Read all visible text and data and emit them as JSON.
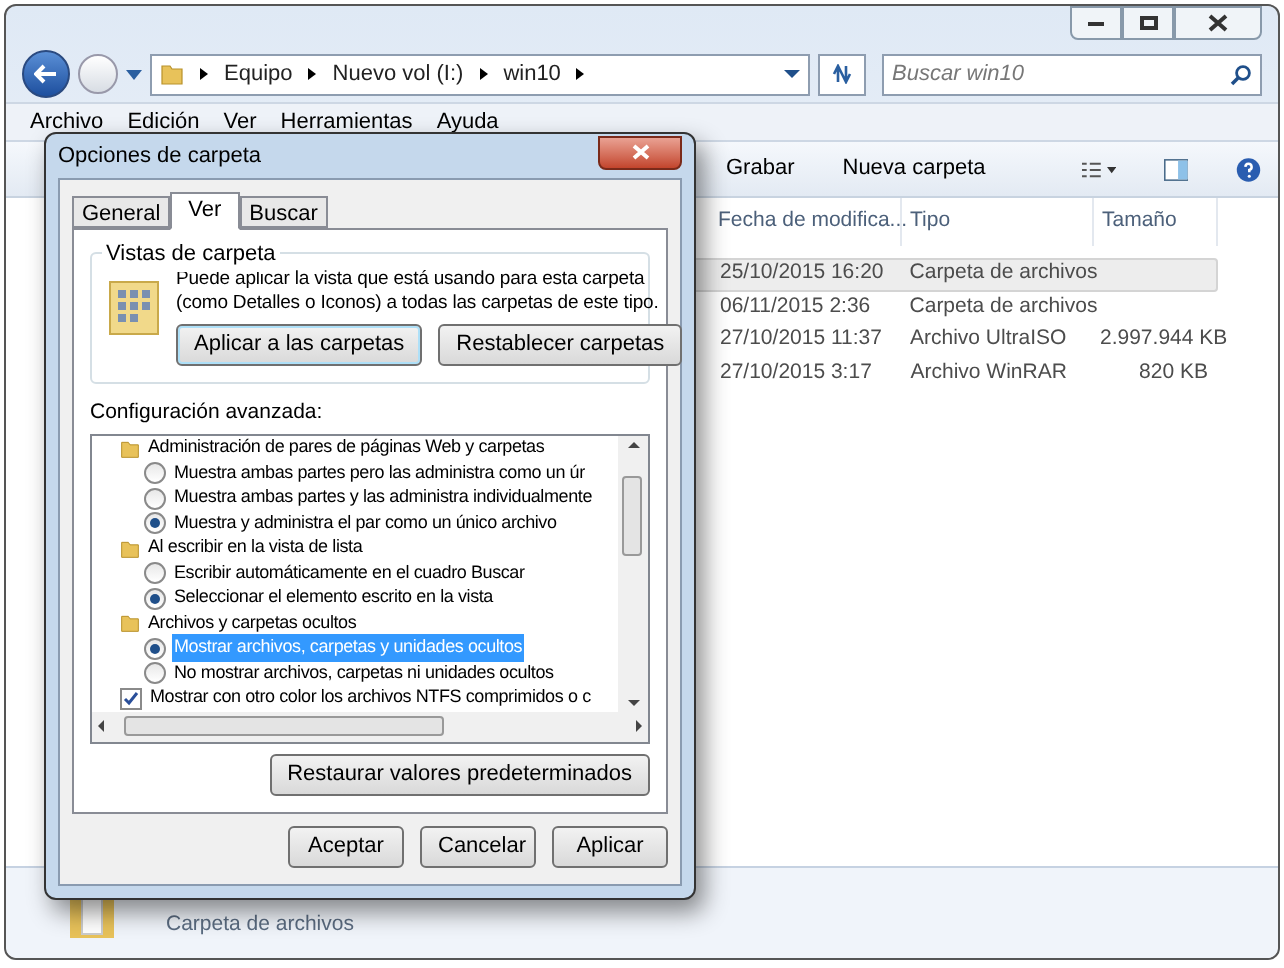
{
  "explorer": {
    "breadcrumb": [
      "Equipo",
      "Nuevo vol (I:)",
      "win10"
    ],
    "search": {
      "placeholder": "Buscar win10"
    },
    "menu": [
      "Archivo",
      "Edición",
      "Ver",
      "Herramientas",
      "Ayuda"
    ],
    "toolbar": [
      "Grabar",
      "Nueva carpeta"
    ],
    "table": {
      "columns": [
        "Fecha de modifica...",
        "Tipo",
        "Tamaño"
      ],
      "rows": [
        {
          "cells": [
            "25/10/2015 16:20",
            "Carpeta de archivos",
            ""
          ],
          "selected": true
        },
        {
          "cells": [
            "06/11/2015 2:36",
            "Carpeta de archivos",
            ""
          ],
          "selected": false
        },
        {
          "cells": [
            "27/10/2015 11:37",
            "Archivo UltraISO",
            "2.997.944 KB"
          ],
          "selected": false
        },
        {
          "cells": [
            "27/10/2015 3:17",
            "Archivo WinRAR",
            "820 KB"
          ],
          "selected": false
        }
      ]
    },
    "details_pane": {
      "type": "Carpeta de archivos"
    }
  },
  "dialog": {
    "title": "Opciones de carpeta",
    "tabs": [
      {
        "label": "General",
        "selected": false
      },
      {
        "label": "Ver",
        "selected": true
      },
      {
        "label": "Buscar",
        "selected": false
      }
    ],
    "folder_views": {
      "legend": "Vistas de carpeta",
      "text": "Puede aplicar la vista que está usando para esta carpeta (como Detalles o Iconos) a todas las carpetas de este tipo.",
      "buttons": [
        "Aplicar a las carpetas",
        "Restablecer carpetas"
      ]
    },
    "advanced": {
      "label": "Configuración avanzada:",
      "items": [
        {
          "kind": "folder",
          "label": "Administración de pares de páginas Web y carpetas",
          "children": [
            {
              "kind": "radio",
              "label": "Muestra ambas partes pero las administra como un úr",
              "checked": false,
              "selected": false
            },
            {
              "kind": "radio",
              "label": "Muestra ambas partes y las administra individualmente",
              "checked": false,
              "selected": false
            },
            {
              "kind": "radio",
              "label": "Muestra y administra el par como un único archivo",
              "checked": true,
              "selected": false
            }
          ]
        },
        {
          "kind": "folder",
          "label": "Al escribir en la vista de lista",
          "children": [
            {
              "kind": "radio",
              "label": "Escribir automáticamente en el cuadro Buscar",
              "checked": false,
              "selected": false
            },
            {
              "kind": "radio",
              "label": "Seleccionar el elemento escrito en la vista",
              "checked": true,
              "selected": false
            }
          ]
        },
        {
          "kind": "folder",
          "label": "Archivos y carpetas ocultos",
          "children": [
            {
              "kind": "radio",
              "label": "Mostrar archivos, carpetas y unidades ocultos",
              "checked": true,
              "selected": true
            },
            {
              "kind": "radio",
              "label": "No mostrar archivos, carpetas ni unidades ocultos",
              "checked": false,
              "selected": false
            }
          ]
        },
        {
          "kind": "checkbox",
          "label": "Mostrar con otro color los archivos NTFS comprimidos o c",
          "checked": true,
          "selected": false
        }
      ]
    },
    "restore_button": "Restaurar valores predeterminados",
    "buttons": [
      "Aceptar",
      "Cancelar",
      "Aplicar"
    ]
  }
}
